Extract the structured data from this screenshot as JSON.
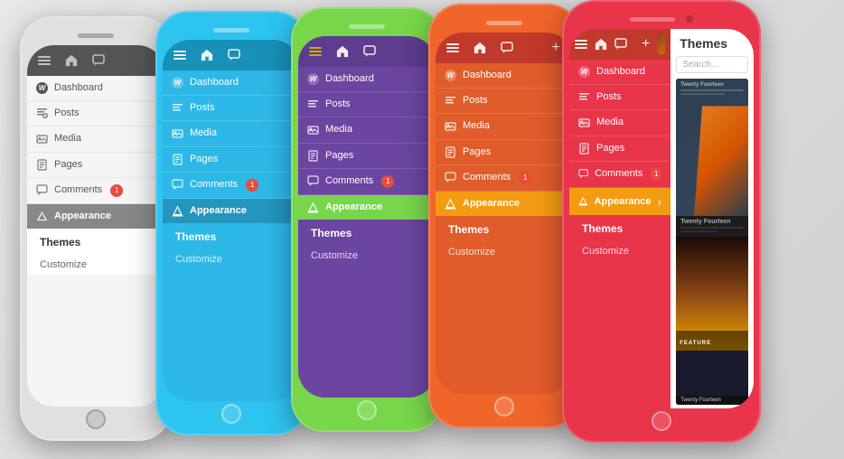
{
  "phones": [
    {
      "id": "white",
      "color": "white",
      "colorClass": "phone-white",
      "borderColor": "#e0e0e0",
      "toolbarBg": "#555555",
      "screenBg": "#f5f5f5",
      "menuColor": "#555",
      "appearanceBg": "#888888",
      "menuItems": [
        {
          "icon": "dashboard",
          "label": "Dashboard"
        },
        {
          "icon": "posts",
          "label": "Posts"
        },
        {
          "icon": "media",
          "label": "Media"
        },
        {
          "icon": "pages",
          "label": "Pages"
        },
        {
          "icon": "comments",
          "label": "Comments",
          "badge": "1"
        }
      ],
      "appearance": {
        "label": "Appearance",
        "active": true
      },
      "subItems": [
        {
          "label": "Themes",
          "bold": true
        },
        {
          "label": "Customize"
        }
      ]
    },
    {
      "id": "blue",
      "color": "blue",
      "colorClass": "phone-blue",
      "borderColor": "#2ec4f0",
      "menuItems": [
        {
          "icon": "dashboard",
          "label": "Dashboard"
        },
        {
          "icon": "posts",
          "label": "Posts"
        },
        {
          "icon": "media",
          "label": "Media"
        },
        {
          "icon": "pages",
          "label": "Pages"
        },
        {
          "icon": "comments",
          "label": "Comments",
          "badge": "1"
        }
      ],
      "appearance": {
        "label": "Appearance",
        "active": true
      },
      "subItems": [
        {
          "label": "Themes",
          "bold": true
        },
        {
          "label": "Customize"
        }
      ]
    },
    {
      "id": "green",
      "color": "green",
      "colorClass": "phone-green",
      "borderColor": "#78d64b",
      "menuItems": [
        {
          "icon": "dashboard",
          "label": "Dashboard"
        },
        {
          "icon": "posts",
          "label": "Posts"
        },
        {
          "icon": "media",
          "label": "Media"
        },
        {
          "icon": "pages",
          "label": "Pages"
        },
        {
          "icon": "comments",
          "label": "Comments",
          "badge": "1"
        }
      ],
      "appearance": {
        "label": "Appearance",
        "active": true
      },
      "subItems": [
        {
          "label": "Themes",
          "bold": true
        },
        {
          "label": "Customize"
        }
      ]
    },
    {
      "id": "orange",
      "color": "orange",
      "colorClass": "phone-orange",
      "borderColor": "#f0652a",
      "menuItems": [
        {
          "icon": "dashboard",
          "label": "Dashboard"
        },
        {
          "icon": "posts",
          "label": "Posts"
        },
        {
          "icon": "media",
          "label": "Media"
        },
        {
          "icon": "pages",
          "label": "Pages"
        },
        {
          "icon": "comments",
          "label": "Comments",
          "badge": "1"
        }
      ],
      "appearance": {
        "label": "Appearance",
        "active": true
      },
      "subItems": [
        {
          "label": "Themes",
          "bold": true
        },
        {
          "label": "Customize"
        }
      ]
    },
    {
      "id": "red",
      "color": "red",
      "colorClass": "phone-red",
      "borderColor": "#e8354a",
      "menuItems": [
        {
          "icon": "dashboard",
          "label": "Dashboard"
        },
        {
          "icon": "posts",
          "label": "Posts"
        },
        {
          "icon": "media",
          "label": "Media"
        },
        {
          "icon": "pages",
          "label": "Pages"
        },
        {
          "icon": "comments",
          "label": "Comments",
          "badge": "1"
        }
      ],
      "appearance": {
        "label": "Appearance",
        "active": true
      },
      "themesPanel": {
        "title": "Themes",
        "searchPlaceholder": "Search...",
        "themeTitle": "Twenty Fourteen",
        "featureLabel": "FEATURE"
      }
    }
  ],
  "labels": {
    "dashboard": "Dashboard",
    "posts": "Posts",
    "media": "Media",
    "pages": "Pages",
    "comments": "Comments",
    "appearance": "Appearance",
    "themes": "Themes",
    "customize": "Customize",
    "badge": "1"
  }
}
